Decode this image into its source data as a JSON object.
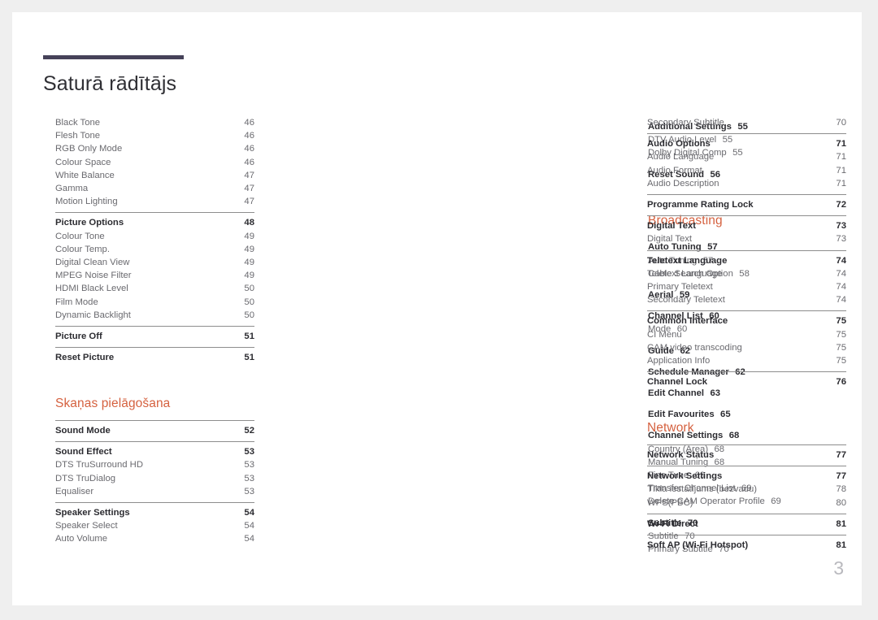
{
  "document": {
    "title": "Saturā rādītājs",
    "page_number": "3",
    "accent_color": "#d5613f",
    "rule_color": "#464259",
    "separator_color": "#8d8d8d",
    "level1_color": "#2c2c31",
    "level2_color": "#6a6a6f",
    "page_number_color": "#b9b9be"
  },
  "columns": [
    {
      "name": "column-1",
      "blocks": [
        {
          "type": "group",
          "ruled": false,
          "rows": [
            {
              "label": "Black Tone",
              "page": "46",
              "level": 2
            },
            {
              "label": "Flesh Tone",
              "page": "46",
              "level": 2
            },
            {
              "label": "RGB Only Mode",
              "page": "46",
              "level": 2
            },
            {
              "label": "Colour Space",
              "page": "46",
              "level": 2
            },
            {
              "label": "White Balance",
              "page": "47",
              "level": 2
            },
            {
              "label": "Gamma",
              "page": "47",
              "level": 2
            },
            {
              "label": "Motion Lighting",
              "page": "47",
              "level": 2
            }
          ]
        },
        {
          "type": "group",
          "ruled": true,
          "rows": [
            {
              "label": "Picture Options",
              "page": "48",
              "level": 1
            },
            {
              "label": "Colour Tone",
              "page": "49",
              "level": 2
            },
            {
              "label": "Colour Temp.",
              "page": "49",
              "level": 2
            },
            {
              "label": "Digital Clean View",
              "page": "49",
              "level": 2
            },
            {
              "label": "MPEG Noise Filter",
              "page": "49",
              "level": 2
            },
            {
              "label": "HDMI Black Level",
              "page": "50",
              "level": 2
            },
            {
              "label": "Film Mode",
              "page": "50",
              "level": 2
            },
            {
              "label": "Dynamic Backlight",
              "page": "50",
              "level": 2
            }
          ]
        },
        {
          "type": "group",
          "ruled": true,
          "rows": [
            {
              "label": "Picture Off",
              "page": "51",
              "level": 1
            }
          ]
        },
        {
          "type": "group",
          "ruled": true,
          "rows": [
            {
              "label": "Reset Picture",
              "page": "51",
              "level": 1
            }
          ]
        },
        {
          "type": "spacer"
        },
        {
          "type": "heading",
          "label": "Skaņas pielāgošana"
        },
        {
          "type": "group",
          "ruled": true,
          "rows": [
            {
              "label": "Sound Mode",
              "page": "52",
              "level": 1
            }
          ]
        },
        {
          "type": "group",
          "ruled": true,
          "rows": [
            {
              "label": "Sound Effect",
              "page": "53",
              "level": 1
            },
            {
              "label": "DTS TruSurround HD",
              "page": "53",
              "level": 2
            },
            {
              "label": "DTS TruDialog",
              "page": "53",
              "level": 2
            },
            {
              "label": "Equaliser",
              "page": "53",
              "level": 2
            }
          ]
        },
        {
          "type": "group",
          "ruled": true,
          "rows": [
            {
              "label": "Speaker Settings",
              "page": "54",
              "level": 1
            },
            {
              "label": "Speaker Select",
              "page": "54",
              "level": 2
            },
            {
              "label": "Auto Volume",
              "page": "54",
              "level": 2
            }
          ]
        }
      ]
    },
    {
      "name": "column-2",
      "blocks": [
        {
          "type": "group",
          "ruled": true,
          "rows": [
            {
              "label": "Additional Settings",
              "page": "55",
              "level": 1
            },
            {
              "label": "DTV Audio Level",
              "page": "55",
              "level": 2
            },
            {
              "label": "Dolby Digital Comp",
              "page": "55",
              "level": 2
            }
          ]
        },
        {
          "type": "group",
          "ruled": true,
          "rows": [
            {
              "label": "Reset Sound",
              "page": "56",
              "level": 1
            }
          ]
        },
        {
          "type": "spacer"
        },
        {
          "type": "heading",
          "label": "Broadcasting"
        },
        {
          "type": "group",
          "ruled": true,
          "rows": [
            {
              "label": "Auto Tuning",
              "page": "57",
              "level": 1
            },
            {
              "label": "Auto Tuning",
              "page": "57",
              "level": 2
            },
            {
              "label": "Cable Search Option",
              "page": "58",
              "level": 2
            }
          ]
        },
        {
          "type": "group",
          "ruled": true,
          "rows": [
            {
              "label": "Aerial",
              "page": "59",
              "level": 1
            }
          ]
        },
        {
          "type": "group",
          "ruled": true,
          "rows": [
            {
              "label": "Channel List",
              "page": "60",
              "level": 1
            },
            {
              "label": "Mode",
              "page": "60",
              "level": 2
            }
          ]
        },
        {
          "type": "group",
          "ruled": true,
          "rows": [
            {
              "label": "Guide",
              "page": "62",
              "level": 1
            }
          ]
        },
        {
          "type": "group",
          "ruled": true,
          "rows": [
            {
              "label": "Schedule Manager",
              "page": "62",
              "level": 1
            }
          ]
        },
        {
          "type": "group",
          "ruled": true,
          "rows": [
            {
              "label": "Edit Channel",
              "page": "63",
              "level": 1
            }
          ]
        },
        {
          "type": "group",
          "ruled": true,
          "rows": [
            {
              "label": "Edit Favourites",
              "page": "65",
              "level": 1
            }
          ]
        },
        {
          "type": "group",
          "ruled": "violet",
          "rows": [
            {
              "label": "Channel Settings",
              "page": "68",
              "level": 1
            },
            {
              "label": "Country (Area)",
              "page": "68",
              "level": 2
            },
            {
              "label": "Manual Tuning",
              "page": "68",
              "level": 2
            },
            {
              "label": "Fine Tune",
              "page": "69",
              "level": 2
            },
            {
              "label": "Transfer Channel List",
              "page": "69",
              "level": 2
            },
            {
              "label": "Delete CAM Operator Profile",
              "page": "69",
              "level": 2
            }
          ]
        },
        {
          "type": "group",
          "ruled": true,
          "rows": [
            {
              "label": "Subtitle",
              "page": "70",
              "level": 1
            },
            {
              "label": "Subtitle",
              "page": "70",
              "level": 2
            },
            {
              "label": "Primary Subtitle",
              "page": "70",
              "level": 2
            }
          ]
        }
      ]
    },
    {
      "name": "column-3",
      "blocks": [
        {
          "type": "group",
          "ruled": false,
          "rows": [
            {
              "label": "Secondary Subtitle",
              "page": "70",
              "level": 2
            }
          ]
        },
        {
          "type": "group",
          "ruled": true,
          "rows": [
            {
              "label": "Audio Options",
              "page": "71",
              "level": 1
            },
            {
              "label": "Audio Language",
              "page": "71",
              "level": 2
            },
            {
              "label": "Audio Format",
              "page": "71",
              "level": 2
            },
            {
              "label": "Audio Description",
              "page": "71",
              "level": 2
            }
          ]
        },
        {
          "type": "group",
          "ruled": true,
          "rows": [
            {
              "label": "Programme Rating Lock",
              "page": "72",
              "level": 1
            }
          ]
        },
        {
          "type": "group",
          "ruled": true,
          "rows": [
            {
              "label": "Digital Text",
              "page": "73",
              "level": 1
            },
            {
              "label": "Digital Text",
              "page": "73",
              "level": 2
            }
          ]
        },
        {
          "type": "group",
          "ruled": true,
          "rows": [
            {
              "label": "Teletext Language",
              "page": "74",
              "level": 1
            },
            {
              "label": "Teletext Language",
              "page": "74",
              "level": 2
            },
            {
              "label": "Primary Teletext",
              "page": "74",
              "level": 2
            },
            {
              "label": "Secondary Teletext",
              "page": "74",
              "level": 2
            }
          ]
        },
        {
          "type": "group",
          "ruled": true,
          "rows": [
            {
              "label": "Common Interface",
              "page": "75",
              "level": 1
            },
            {
              "label": "CI Menu",
              "page": "75",
              "level": 2
            },
            {
              "label": "CAM video transcoding",
              "page": "75",
              "level": 2
            },
            {
              "label": "Application Info",
              "page": "75",
              "level": 2
            }
          ]
        },
        {
          "type": "group",
          "ruled": true,
          "rows": [
            {
              "label": "Channel Lock",
              "page": "76",
              "level": 1
            }
          ]
        },
        {
          "type": "spacer"
        },
        {
          "type": "heading",
          "label": "Network"
        },
        {
          "type": "group",
          "ruled": true,
          "rows": [
            {
              "label": "Network Status",
              "page": "77",
              "level": 1
            }
          ]
        },
        {
          "type": "group",
          "ruled": true,
          "rows": [
            {
              "label": "Network Settings",
              "page": "77",
              "level": 1
            },
            {
              "label": "Tīkla iestatījums (bezvadu)",
              "page": "78",
              "level": 2
            },
            {
              "label": "WPS(PBC)",
              "page": "80",
              "level": 2
            }
          ]
        },
        {
          "type": "group",
          "ruled": true,
          "rows": [
            {
              "label": "Wi-Fi Direct",
              "page": "81",
              "level": 1
            }
          ]
        },
        {
          "type": "group",
          "ruled": true,
          "rows": [
            {
              "label": "Soft AP (Wi-Fi Hotspot)",
              "page": "81",
              "level": 1
            }
          ]
        }
      ]
    }
  ]
}
